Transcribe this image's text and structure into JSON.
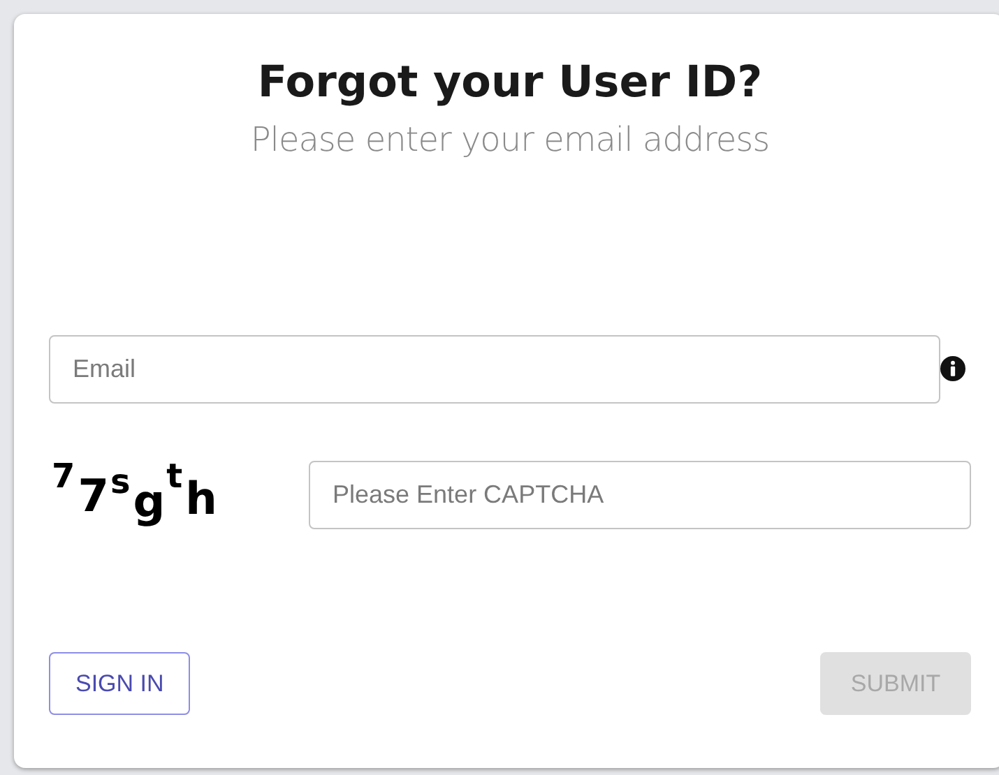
{
  "title": "Forgot your User ID?",
  "subtitle": "Please enter your email address",
  "email_field": {
    "placeholder": "Email"
  },
  "captcha": "77sgth",
  "captcha_field": {
    "placeholder": "Please Enter CAPTCHA"
  },
  "buttons": [
    {
      "label": "SIGN IN",
      "kind": "outline",
      "disabled": false
    },
    {
      "label": "SUBMIT",
      "kind": "filled",
      "disabled": true
    }
  ]
}
